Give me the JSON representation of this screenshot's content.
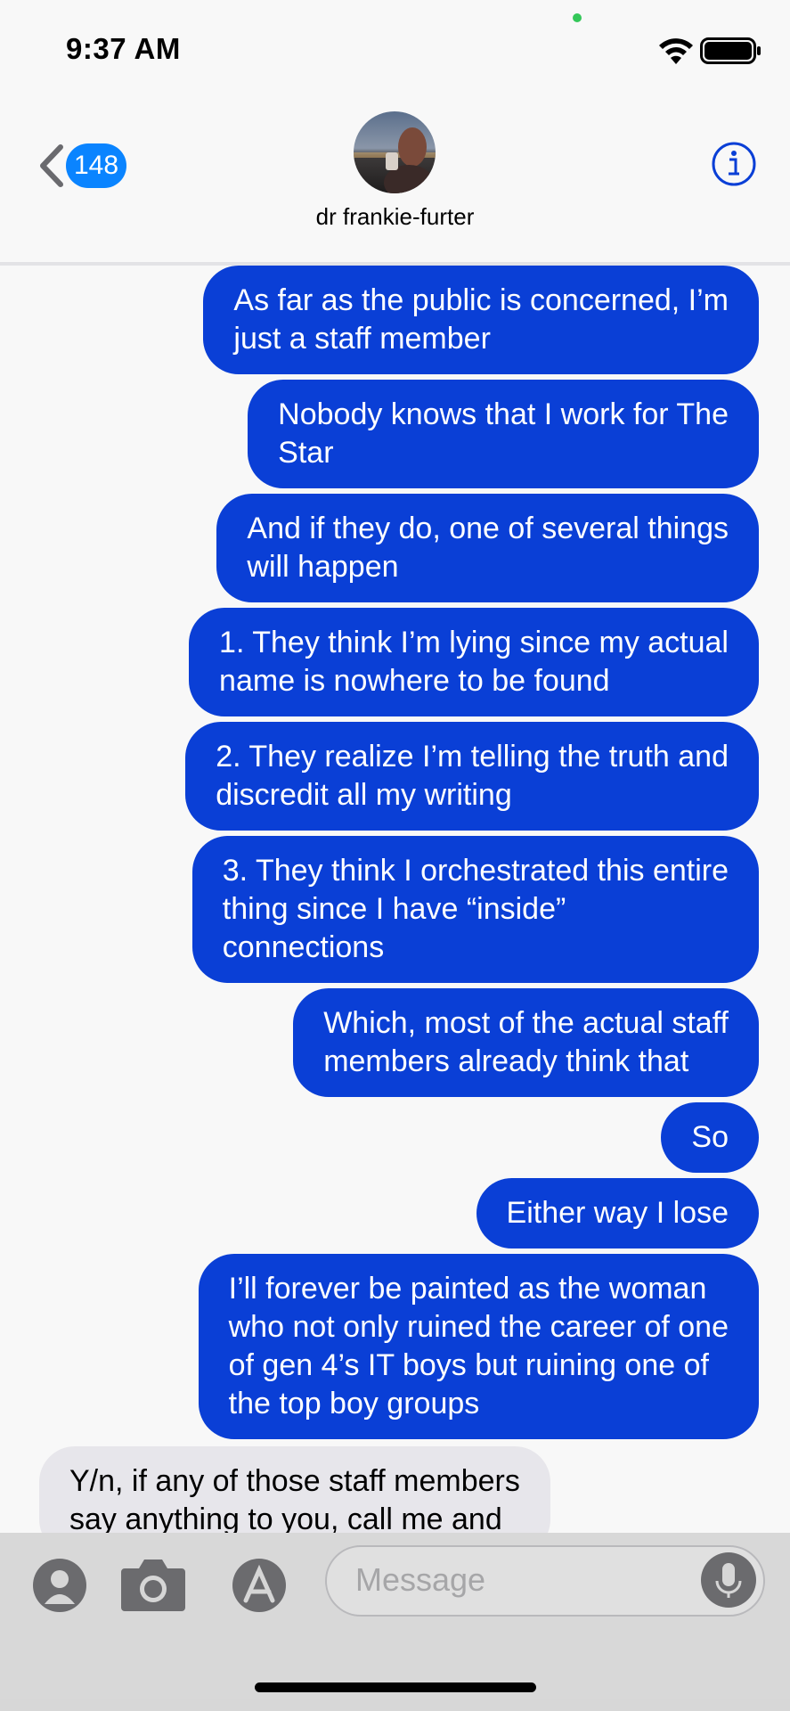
{
  "status_bar": {
    "time": "9:37 AM",
    "privacy_dot_color": "#34c759"
  },
  "header": {
    "back_badge_count": "148",
    "contact_name": "dr frankie-furter",
    "info_icon": "info-circle-icon",
    "accent_color": "#0a84ff"
  },
  "messages": [
    {
      "direction": "sent",
      "text": "As far as the public is concerned, I’m\njust a staff member"
    },
    {
      "direction": "sent",
      "text": "Nobody knows that I work for The\nStar"
    },
    {
      "direction": "sent",
      "text": "And if they do, one of several things\nwill happen"
    },
    {
      "direction": "sent",
      "text": "1. They think I’m lying since my actual\nname is nowhere to be found"
    },
    {
      "direction": "sent",
      "text": "2. They realize I’m telling the truth and\ndiscredit all my writing"
    },
    {
      "direction": "sent",
      "text": "3. They think I orchestrated this entire\nthing since I have “inside”\nconnections"
    },
    {
      "direction": "sent",
      "text": "Which, most of the actual staff\nmembers already think that"
    },
    {
      "direction": "sent",
      "text": "So"
    },
    {
      "direction": "sent",
      "text": "Either way I lose"
    },
    {
      "direction": "sent",
      "text": "I’ll forever be painted as the woman\nwho not only ruined the career of one\nof gen 4’s IT boys but ruining one of\nthe top boy groups"
    },
    {
      "direction": "received",
      "text": "Y/n, if any of those staff members\nsay anything to you, call me and"
    }
  ],
  "input_bar": {
    "placeholder": "Message",
    "icons": [
      "memoji-icon",
      "camera-icon",
      "app-store-icon",
      "microphone-icon"
    ]
  },
  "colors": {
    "sent_bubble": "#0a3fd6",
    "received_bubble": "#e7e6eb"
  }
}
